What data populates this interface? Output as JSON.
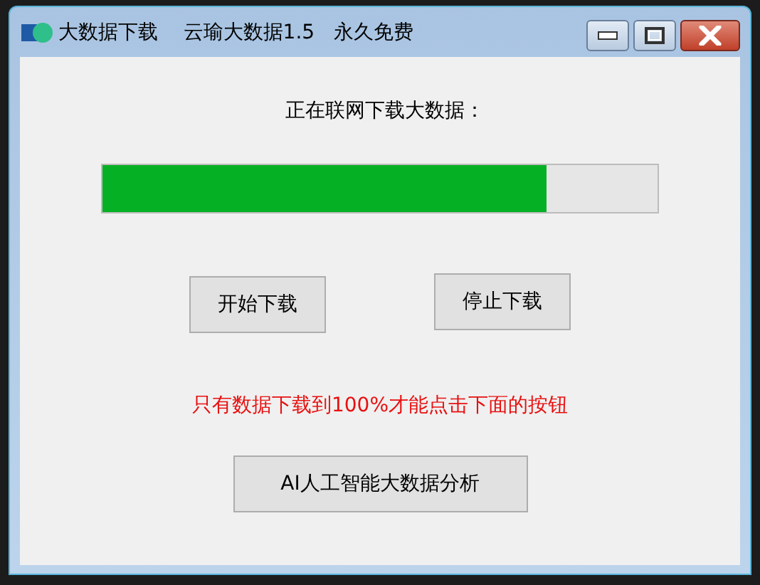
{
  "window": {
    "title": "大数据下载    云瑜大数据1.5   永久免费"
  },
  "heading": "正在联网下载大数据：",
  "progress": {
    "level": 0.8
  },
  "buttons": [
    "开始下载",
    "停止下载"
  ],
  "notice": "只有数据下载到100%才能点击下面的按钮",
  "analysis_button": "AI人工智能大数据分析"
}
